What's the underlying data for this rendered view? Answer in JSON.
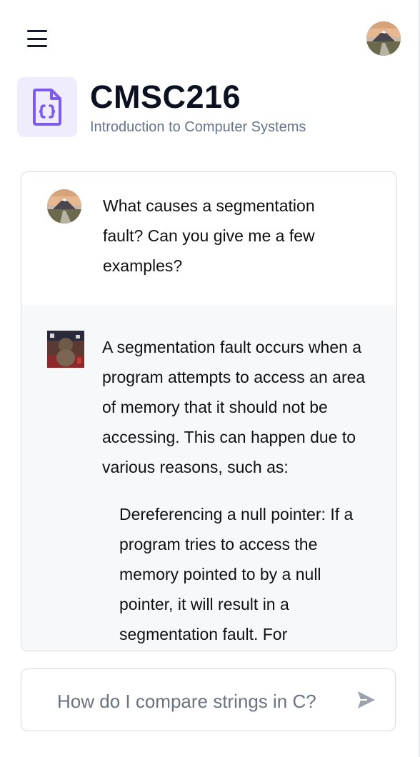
{
  "header": {
    "menu_icon": "hamburger-menu-icon",
    "profile_avatar": "user-avatar"
  },
  "course": {
    "icon": "code-file-icon",
    "accent_color": "#7c5ce8",
    "code": "CMSC216",
    "name": "Introduction to Computer Systems"
  },
  "chat": {
    "user_message": "What causes a segmentation fault? Can you give me a few examples?",
    "assistant_message": "A segmentation fault occurs when a program attempts to access an area of memory that it should not be accessing. This can happen due to various reasons, such as:",
    "assistant_list_item": "Dereferencing a null pointer: If a program tries to access the memory pointed to by a null pointer, it will result in a segmentation fault. For"
  },
  "composer": {
    "placeholder": "How do I compare strings in C?",
    "send_icon": "send-arrow-icon"
  }
}
